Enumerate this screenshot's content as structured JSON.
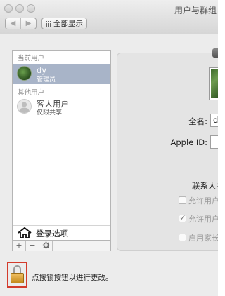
{
  "window": {
    "title": "用户与群组",
    "show_all_label": "全部显示",
    "back_glyph": "◀",
    "forward_glyph": "▶",
    "accent_color": "#e8642a"
  },
  "sidebar": {
    "current_users_title": "当前用户",
    "other_users_title": "其他用户",
    "users": [
      {
        "name": "dy",
        "role": "管理员",
        "selected": true,
        "avatar": "green-photo-avatar"
      },
      {
        "name": "客人用户",
        "role": "仅限共享",
        "selected": false,
        "avatar": "guest-silhouette-icon"
      }
    ],
    "login_options_label": "登录选项",
    "toolbar": {
      "add": "+",
      "remove": "−",
      "gear_icon": "gear-icon"
    },
    "selection_color": "#a8b4c8"
  },
  "details": {
    "full_name_label": "全名:",
    "full_name_value": "d",
    "apple_id_label": "Apple ID:",
    "contacts_label": "联系人名",
    "options": [
      {
        "label": "允许用户",
        "checked": false
      },
      {
        "label": "允许用户",
        "checked": true
      },
      {
        "label": "启用家长",
        "checked": false
      }
    ]
  },
  "footer": {
    "lock_text": "点按锁按钮以进行更改。",
    "lock_icon": "padlock-icon",
    "highlight_color": "#d33b2c"
  }
}
